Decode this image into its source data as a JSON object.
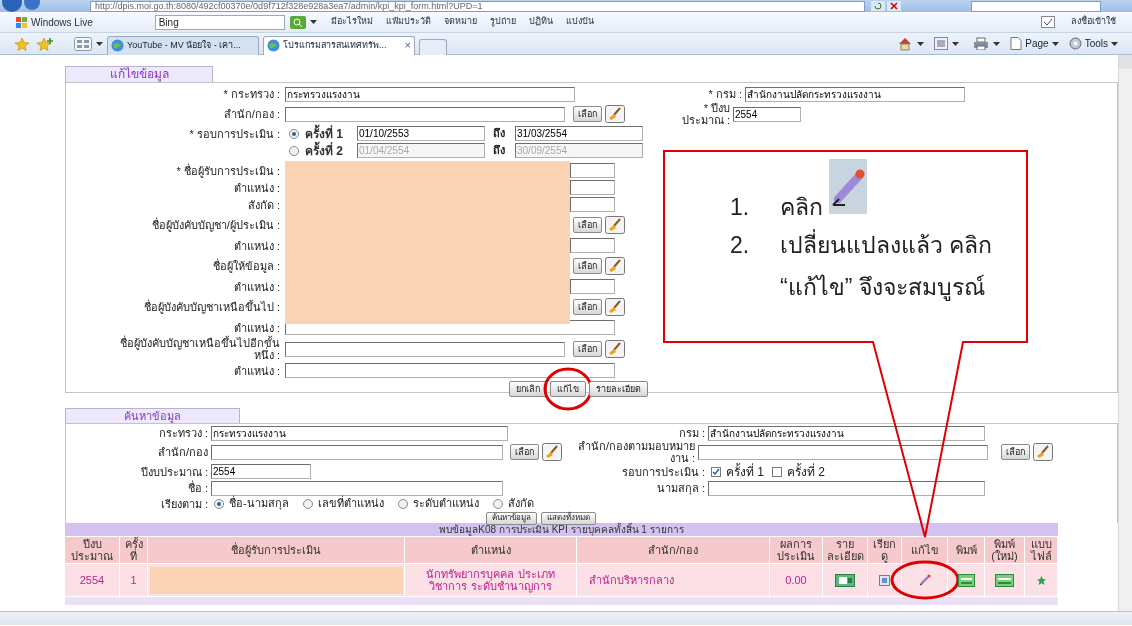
{
  "browser": {
    "url": "http://dpis.moi.go.th:8080/492cf00370e/0d9f712f328e928a3ea7/admin/kpi_kpi_form.html?UPD=1",
    "toolbar": {
      "brand": "Windows Live",
      "search_value": "Bing",
      "links": [
        "มีอะไรใหม่",
        "แฟ้มประวัติ",
        "จดหมาย",
        "รูปถ่าย",
        "ปฏิทิน",
        "แบ่งปัน"
      ],
      "sign_in": "ลงชื่อเข้าใช้"
    },
    "tabs": [
      {
        "label": "YouTube - MV น้อยใจ - เคา...",
        "selected": false
      },
      {
        "label": "โปรแกรมสารสนเทศทรัพ...",
        "selected": true
      }
    ],
    "tab_close": "×",
    "commands": [
      "Page",
      "Tools"
    ]
  },
  "edit_form": {
    "title": "แก้ไขข้อมูล",
    "redacted": true,
    "ministry": {
      "label": "* กระทรวง :",
      "value": "กระทรวงแรงงาน"
    },
    "department": {
      "label": "* กรม :",
      "value": "สำนักงานปลัดกระทรวงแรงงาน"
    },
    "division": {
      "label": "สำนัก/กอง :",
      "button": "เลือก"
    },
    "fiscal_year": {
      "label": "* ปีงบ\nประมาณ :",
      "value": "2554"
    },
    "round": {
      "label": "* รอบการประเมิน :",
      "options": [
        {
          "label": "ครั้งที่ 1",
          "selected": true,
          "from": "01/10/2553",
          "to_label": "ถึง",
          "to": "31/03/2554"
        },
        {
          "label": "ครั้งที่ 2",
          "selected": false,
          "from": "01/04/2554",
          "to_label": "ถึง",
          "to": "30/09/2554"
        }
      ]
    },
    "person_rows": [
      {
        "label": "* ชื่อผู้รับการประเมิน :",
        "kind": "field"
      },
      {
        "label": "ตำแหน่ง :",
        "kind": "field"
      },
      {
        "label": "สังกัด :",
        "kind": "field"
      },
      {
        "label": "ชื่อผู้บังคับบัญชา/ผู้ประเมิน :",
        "kind": "picker",
        "button": "เลือก"
      },
      {
        "label": "ตำแหน่ง :",
        "kind": "field"
      },
      {
        "label": "ชื่อผู้ให้ข้อมูล :",
        "kind": "picker",
        "button": "เลือก"
      },
      {
        "label": "ตำแหน่ง :",
        "kind": "field"
      },
      {
        "label": "ชื่อผู้บังคับบัญชาเหนือขึ้นไป :",
        "kind": "picker",
        "button": "เลือก"
      },
      {
        "label": "ตำแหน่ง :",
        "kind": "field"
      },
      {
        "label": "ชื่อผู้บังคับบัญชาเหนือขึ้นไปอีกขั้น\nหนึ่ง :",
        "kind": "picker",
        "button": "เลือก"
      },
      {
        "label": "ตำแหน่ง :",
        "kind": "field"
      }
    ],
    "buttons": [
      {
        "label": "ยกเลิก",
        "circled": false
      },
      {
        "label": "แก้ไข",
        "circled": true
      },
      {
        "label": "รายละเอียด",
        "circled": false
      }
    ]
  },
  "search_form": {
    "title": "ค้นหาข้อมูล",
    "ministry": {
      "label": "กระทรวง :",
      "value": "กระทรวงแรงงาน"
    },
    "department": {
      "label": "กรม :",
      "value": "สำนักงานปลัดกระทรวงแรงงาน"
    },
    "division": {
      "label": "สำนัก/กอง",
      "button": "เลือก"
    },
    "assigned_division": {
      "label": "สำนัก/กองตามมอบหมาย\nงาน :",
      "button": "เลือก"
    },
    "fiscal_year": {
      "label": "ปีงบประมาณ :",
      "value": "2554"
    },
    "round": {
      "label": "รอบการประเมิน :",
      "options": [
        {
          "label": "ครั้งที่ 1",
          "checked": true
        },
        {
          "label": "ครั้งที่ 2",
          "checked": false
        }
      ]
    },
    "first_name": {
      "label": "ชื่อ :"
    },
    "last_name": {
      "label": "นามสกุล :"
    },
    "sort": {
      "label": "เรียงตาม :",
      "options": [
        {
          "label": "ชื่อ-นามสกุล",
          "selected": true
        },
        {
          "label": "เลขที่ตำแหน่ง",
          "selected": false
        },
        {
          "label": "ระดับตำแหน่ง",
          "selected": false
        },
        {
          "label": "สังกัด",
          "selected": false
        }
      ]
    },
    "buttons": [
      "ค้นหาข้อมูล",
      "แสดงทั้งหมด"
    ]
  },
  "results": {
    "summary": "พบข้อมูลK08 การประเมิน KPI รายบุคคลทั้งสิ้น 1 รายการ",
    "columns": [
      "ปีงบ\nประมาณ",
      "ครั้ง\nที่",
      "ชื่อผู้รับการประเมิน",
      "ตำแหน่ง",
      "สำนัก/กอง",
      "ผลการ\nประเมิน",
      "ราย\nละเอียด",
      "เรียก\nดู",
      "แก้ไข",
      "พิมพ์",
      "พิมพ์\n(ใหม่)",
      "แบบ\nไฟล์"
    ],
    "rows": [
      {
        "fiscal_year": "2554",
        "round": "1",
        "name_redacted": true,
        "position": "นักทรัพยากรบุคคล ประเภทวิชาการ ระดับชำนาญการ",
        "division": "สำนักบริหารกลาง",
        "score": "0.00",
        "actions": [
          {
            "kind": "details",
            "circled": false
          },
          {
            "kind": "view",
            "circled": false
          },
          {
            "kind": "edit",
            "circled": true
          },
          {
            "kind": "print",
            "circled": false
          },
          {
            "kind": "print_new",
            "circled": false
          },
          {
            "kind": "file",
            "circled": false
          }
        ]
      }
    ]
  },
  "callout": {
    "steps": [
      {
        "number": "1.",
        "text": "คลิก",
        "kind": "with_icon"
      },
      {
        "number": "2.",
        "text": "เปลี่ยนแปลงแล้ว คลิก “แก้ไข” จึงจะสมบูรณ์",
        "kind": "text"
      }
    ]
  }
}
